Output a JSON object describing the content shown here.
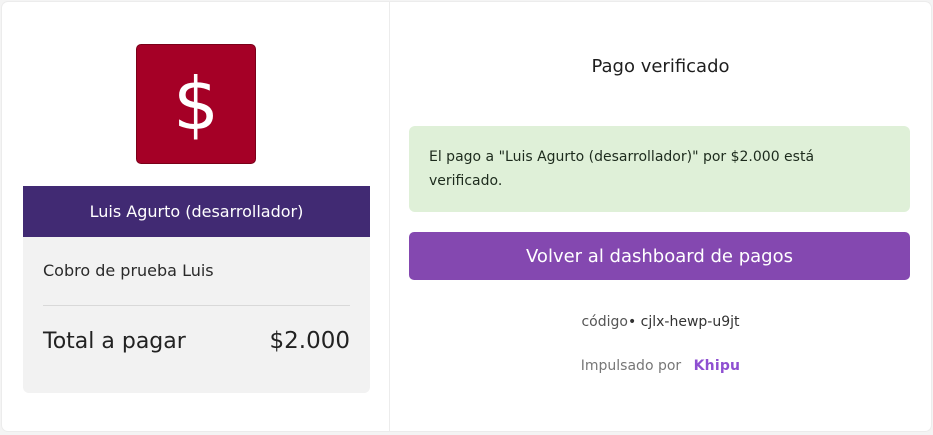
{
  "colors": {
    "logo_bg": "#a50026",
    "merchant_bar_bg": "#412a73",
    "alert_bg": "#dff0d8",
    "button_bg": "#8448b0",
    "brand_purple": "#8e4fd1"
  },
  "merchant": {
    "logo_symbol": "$",
    "name": "Luis Agurto (desarrollador)"
  },
  "summary": {
    "concept": "Cobro de prueba Luis",
    "total_label": "Total a pagar",
    "total_value": "$2.000"
  },
  "status": {
    "title": "Pago verificado",
    "message": "El pago a \"Luis Agurto (desarrollador)\" por $2.000 está verificado."
  },
  "actions": {
    "back_button": "Volver al dashboard de pagos"
  },
  "footer": {
    "code_label": "código",
    "code_value": "cjlx-hewp-u9jt",
    "powered_by": "Impulsado por",
    "brand": "Khipu"
  }
}
